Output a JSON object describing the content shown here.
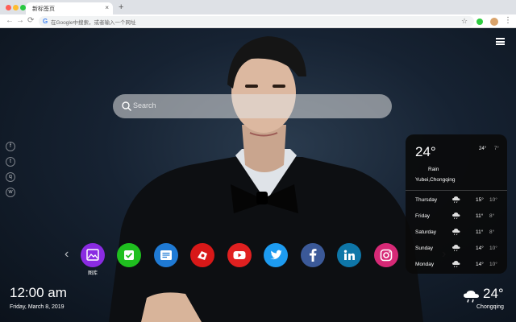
{
  "browser": {
    "tab_title": "新标签页",
    "tab_close": "×",
    "new_tab": "+",
    "omnibox_placeholder": "在Google中搜索，或者输入一个网址",
    "bookmark_icon": "star-icon"
  },
  "search": {
    "placeholder": "Search"
  },
  "apps": [
    {
      "name": "gallery",
      "label": "图库",
      "color": "#8a2be2"
    },
    {
      "name": "tasks",
      "color": "#1fbf1f"
    },
    {
      "name": "notes",
      "color": "#1f7ad4"
    },
    {
      "name": "games",
      "color": "#d81818"
    },
    {
      "name": "youtube",
      "color": "#e02020"
    },
    {
      "name": "twitter",
      "color": "#1d9bf0"
    },
    {
      "name": "facebook",
      "color": "#3b5998"
    },
    {
      "name": "linkedin",
      "color": "#0e76a8"
    },
    {
      "name": "instagram",
      "color": "#d62976"
    }
  ],
  "weather": {
    "temp": "24°",
    "high": "24°",
    "low": "7°",
    "condition": "Rain",
    "location": "Yubei,Chongqing",
    "forecast": [
      {
        "day": "Thursday",
        "high": "15°",
        "low": "10°"
      },
      {
        "day": "Friday",
        "high": "11°",
        "low": "8°"
      },
      {
        "day": "Saturday",
        "high": "11°",
        "low": "8°"
      },
      {
        "day": "Sunday",
        "high": "14°",
        "low": "10°"
      },
      {
        "day": "Monday",
        "high": "14°",
        "low": "10°"
      }
    ]
  },
  "clock": {
    "time": "12:00 am",
    "date": "Friday, March 8, 2019"
  },
  "current_weather": {
    "temp": "24°",
    "city": "Chongqing"
  }
}
